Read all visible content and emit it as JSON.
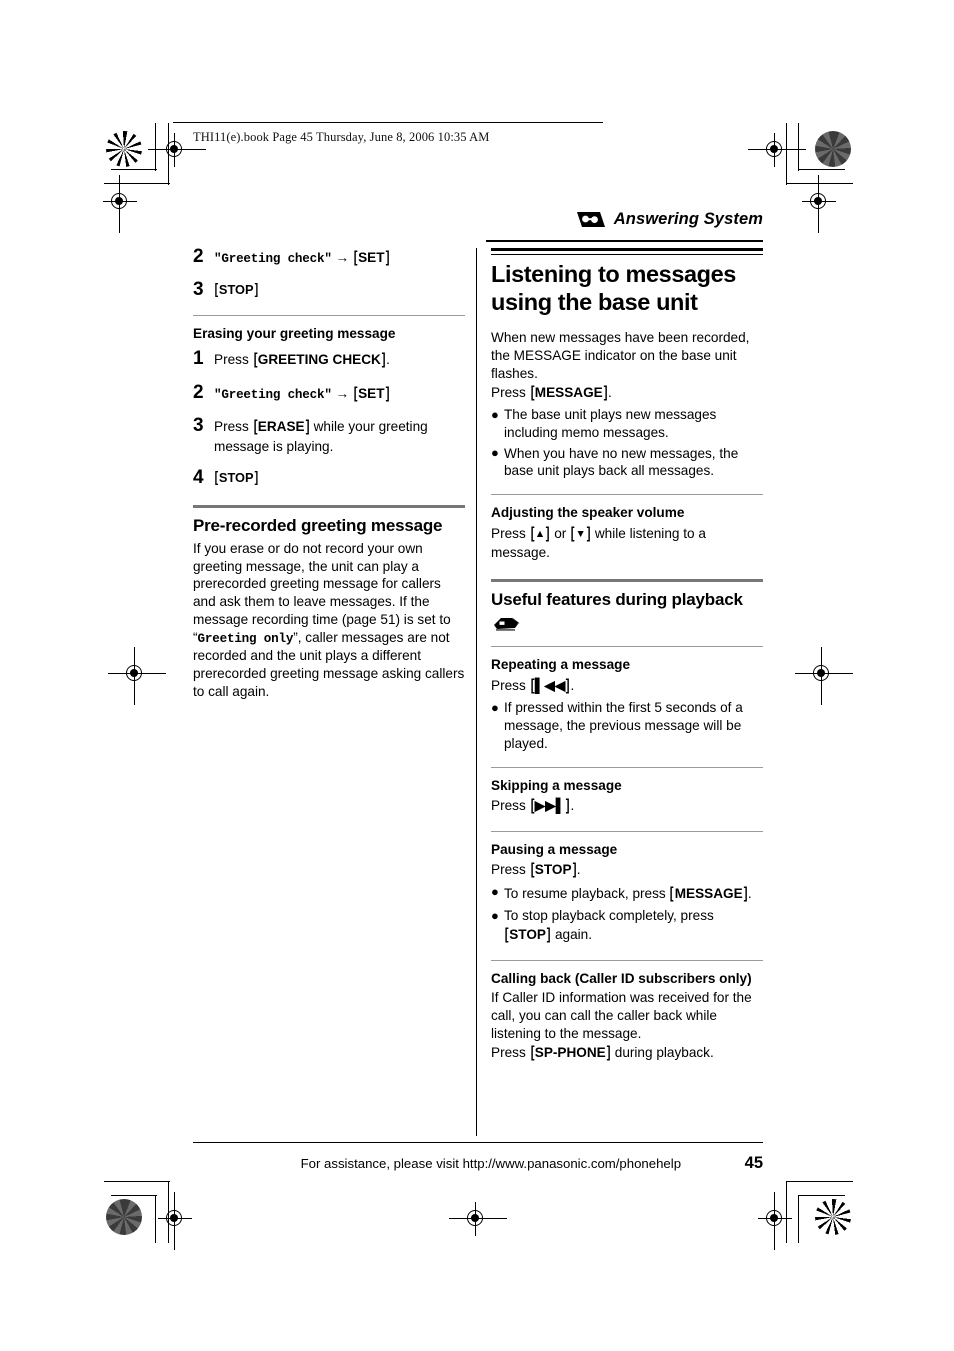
{
  "file_info": "THI11(e).book  Page 45  Thursday, June 8, 2006  10:35 AM",
  "header": {
    "icon": "cassette-tape-icon",
    "title": "Answering System"
  },
  "left_column": {
    "continued_steps": [
      {
        "num": "2",
        "mono": "\"Greeting check\"",
        "arrow": "→",
        "key": "[SET]"
      },
      {
        "num": "3",
        "key": "[STOP]"
      }
    ],
    "erasing_section": {
      "heading": "Erasing your greeting message",
      "steps": [
        {
          "num": "1",
          "pre": "Press ",
          "key": "[GREETING CHECK]",
          "post": "."
        },
        {
          "num": "2",
          "mono": "\"Greeting check\"",
          "arrow": "→",
          "key": "[SET]"
        },
        {
          "num": "3",
          "pre": "Press ",
          "key": "[ERASE]",
          "post": " while your greeting message is playing."
        },
        {
          "num": "4",
          "key": "[STOP]"
        }
      ]
    },
    "prerecorded_section": {
      "heading": "Pre-recorded greeting message",
      "paragraph_part1": "If you erase or do not record your own greeting message, the unit can play a prerecorded greeting message for callers and ask them to leave messages. If the message recording time (page 51) is set to “",
      "paragraph_mono": "Greeting only",
      "paragraph_part2": "”, caller messages are not recorded and the unit plays a different prerecorded greeting message asking callers to call again."
    }
  },
  "right_column": {
    "main_heading": "Listening to messages using the base unit",
    "intro_paragraph": "When new messages have been recorded, the MESSAGE indicator on the base unit flashes.",
    "intro_press_pre": "Press ",
    "intro_press_key": "[MESSAGE]",
    "intro_press_post": ".",
    "intro_bullets": [
      "The base unit plays new messages including memo messages.",
      "When you have no new messages, the base unit plays back all messages."
    ],
    "volume_section": {
      "heading": "Adjusting the speaker volume",
      "press_pre": "Press ",
      "key_up": "[▲]",
      "mid": " or ",
      "key_down": "[▼]",
      "post": " while listening to a message."
    },
    "useful_section": {
      "heading": "Useful features during playback",
      "icon": "base-unit-icon"
    },
    "repeating_section": {
      "heading": "Repeating a message",
      "press_pre": "Press ",
      "key": "[❘◀◀]",
      "press_post": ".",
      "bullets": [
        "If pressed within the first 5 seconds of a message, the previous message will be played."
      ]
    },
    "skipping_section": {
      "heading": "Skipping a message",
      "press_pre": "Press ",
      "key": "[▶▶❘]",
      "press_post": "."
    },
    "pausing_section": {
      "heading": "Pausing a message",
      "press_pre": "Press ",
      "key": "[STOP]",
      "press_post": ".",
      "bullets": [
        {
          "pre": "To resume playback, press ",
          "key": "[MESSAGE]",
          "post": "."
        },
        {
          "pre": "To stop playback completely, press ",
          "key": "[STOP]",
          "post": " again."
        }
      ]
    },
    "calling_back_section": {
      "heading": "Calling back (Caller ID subscribers only)",
      "paragraph": "If Caller ID information was received for the call, you can call the caller back while listening to the message.",
      "press_pre": "Press ",
      "key": "[SP-PHONE]",
      "press_post": " during playback."
    }
  },
  "footer": {
    "text": "For assistance, please visit http://www.panasonic.com/phonehelp",
    "page_number": "45"
  }
}
